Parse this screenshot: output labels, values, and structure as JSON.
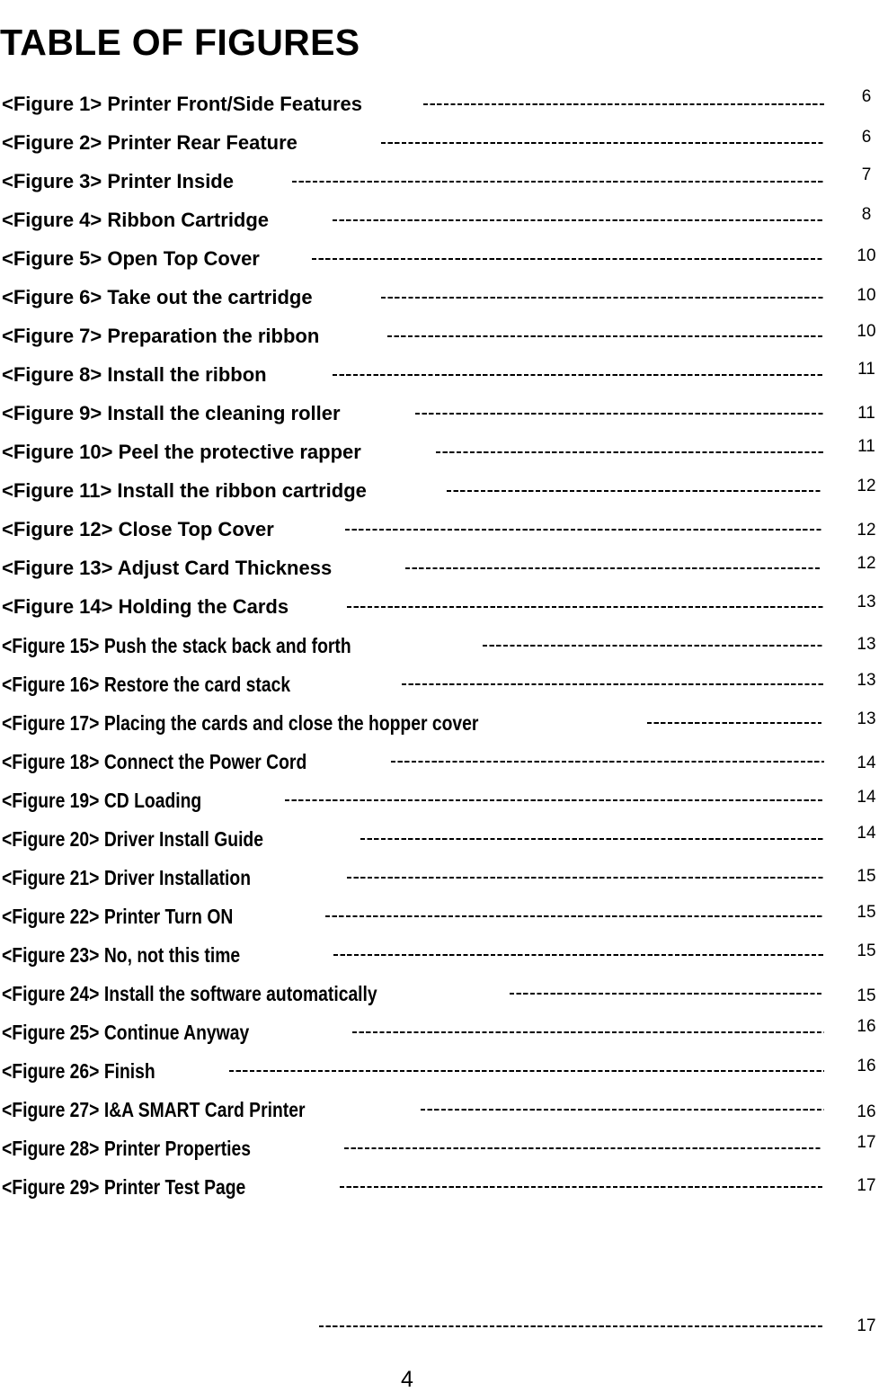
{
  "document": {
    "title": "TABLE OF FIGURES",
    "page_number": "4"
  },
  "entries": [
    {
      "label": "<Figure 1> Printer Front/Side Features",
      "page": "6"
    },
    {
      "label": "<Figure 2> Printer Rear Feature",
      "page": "6"
    },
    {
      "label": "<Figure 3> Printer Inside",
      "page": "7"
    },
    {
      "label": "<Figure 4> Ribbon Cartridge",
      "page": "8"
    },
    {
      "label": "<Figure 5> Open Top Cover",
      "page": "10"
    },
    {
      "label": "<Figure 6> Take out the cartridge",
      "page": "10"
    },
    {
      "label": "<Figure 7> Preparation the ribbon",
      "page": "10"
    },
    {
      "label": "<Figure 8> Install the ribbon",
      "page": "11"
    },
    {
      "label": "<Figure 9> Install the cleaning roller",
      "page": "11"
    },
    {
      "label": "<Figure 10> Peel the protective rapper",
      "page": "11"
    },
    {
      "label": "<Figure 11> Install the ribbon cartridge",
      "page": "12"
    },
    {
      "label": "<Figure 12> Close Top Cover",
      "page": "12"
    },
    {
      "label": "<Figure 13> Adjust Card Thickness",
      "page": "12"
    },
    {
      "label": "<Figure 14> Holding the Cards",
      "page": "13"
    },
    {
      "label": "<Figure 15> Push the stack back and forth",
      "page": "13"
    },
    {
      "label": "<Figure 16> Restore the card stack",
      "page": "13"
    },
    {
      "label": "<Figure 17> Placing the cards and close the hopper cover",
      "page": "13"
    },
    {
      "label": "<Figure 18> Connect the Power Cord",
      "page": "14"
    },
    {
      "label": "<Figure 19> CD Loading",
      "page": "14"
    },
    {
      "label": "<Figure 20> Driver Install Guide",
      "page": "14"
    },
    {
      "label": "<Figure 21> Driver Installation",
      "page": "15"
    },
    {
      "label": "<Figure 22> Printer Turn ON",
      "page": "15"
    },
    {
      "label": "<Figure 23> No, not this time",
      "page": "15"
    },
    {
      "label": "<Figure 24> Install the software automatically",
      "page": "15"
    },
    {
      "label": "<Figure 25> Continue Anyway",
      "page": "16"
    },
    {
      "label": "<Figure 26> Finish",
      "page": "16"
    },
    {
      "label": "<Figure 27> I&A SMART Card Printer",
      "page": "16"
    },
    {
      "label": "<Figure 28> Printer Properties",
      "page": "17"
    },
    {
      "label": "<Figure 29> Printer Test Page",
      "page": "17"
    }
  ],
  "orphan_entry": {
    "label": "",
    "page": "17"
  }
}
